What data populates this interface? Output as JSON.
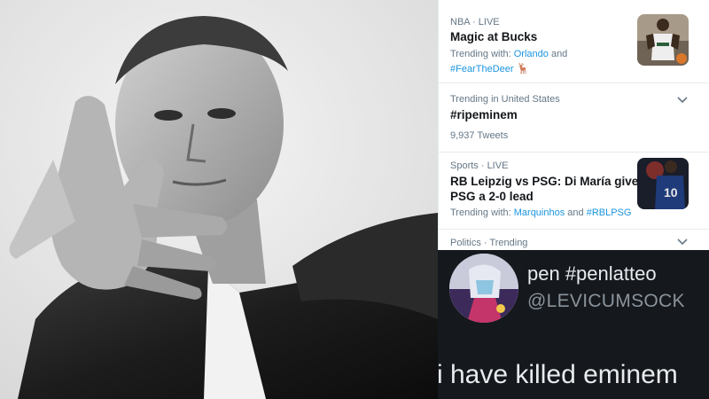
{
  "trends": [
    {
      "meta": "NBA · LIVE",
      "title": "Magic at Bucks",
      "trending_with_prefix": "Trending with: ",
      "trending_with_link1": "Orlando",
      "and_text": " and",
      "trending_with_link2": "#FearTheDeer",
      "thumbnail": "basketball-player-photo"
    },
    {
      "meta": "Trending in United States",
      "title": "#ripeminem",
      "tweets": "9,937 Tweets",
      "icon": "chevron-down-icon"
    },
    {
      "meta": "Sports · LIVE",
      "title_line1": "RB Leipzig vs PSG: Di María gives",
      "title_line2": "PSG a 2-0 lead",
      "trending_with_prefix": "Trending with: ",
      "trending_with_link1": "Marquinhos",
      "and_text": " and ",
      "trending_with_link2": "#RBLPSG",
      "thumbnail": "soccer-player-photo"
    },
    {
      "meta": "Politics · Trending",
      "icon": "chevron-down-icon"
    }
  ],
  "tweet": {
    "display_name": "pen #penlatteo",
    "handle": "@LEVICUMSOCK",
    "text": "i have killed eminem"
  },
  "colors": {
    "link": "#1b95e0",
    "meta": "#657786",
    "title": "#14171a",
    "dark_bg": "#15181c"
  }
}
